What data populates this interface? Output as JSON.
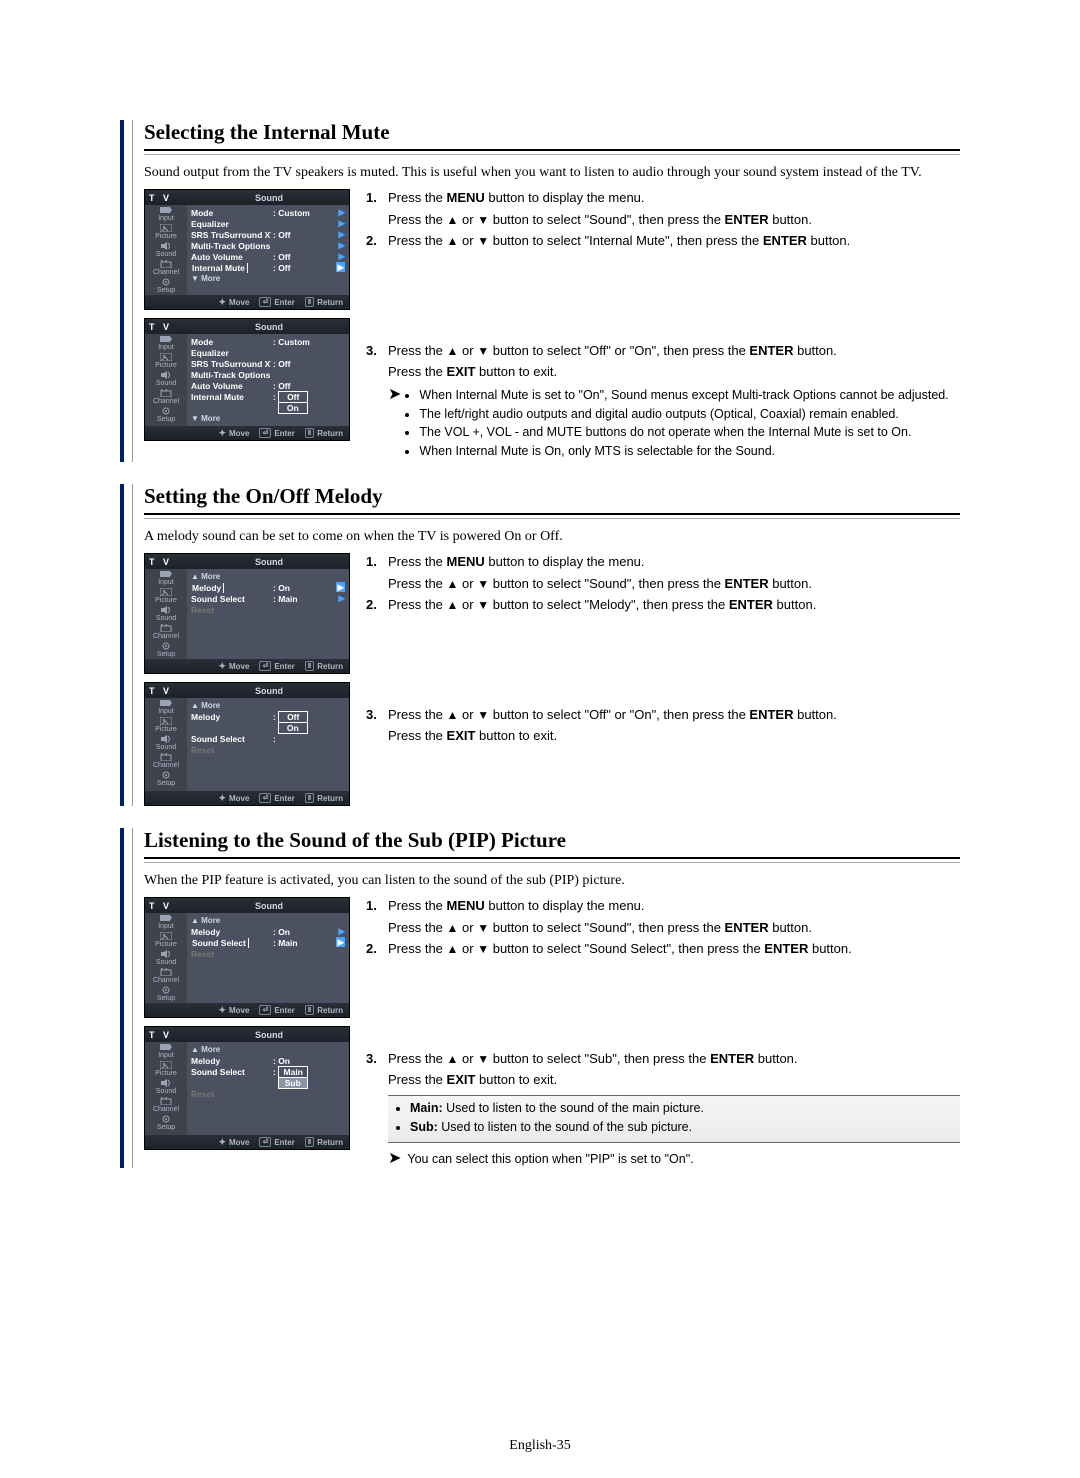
{
  "page_number": "English-35",
  "arrows": {
    "up": "▲",
    "down": "▼",
    "right": "▶",
    "callout": "➤"
  },
  "tv_label": "T V",
  "sidebar": [
    "Input",
    "Picture",
    "Sound",
    "Channel",
    "Setup"
  ],
  "footer": {
    "move": "Move",
    "enter": "Enter",
    "return": "Return"
  },
  "sec1": {
    "title": "Selecting the Internal Mute",
    "intro": "Sound output from the TV speakers is muted. This is useful when you want to listen to audio through your sound system instead of the TV.",
    "step1a": "Press the MENU button to display the menu.",
    "step1b_pre": "Press the ",
    "step1b_mid": " or ",
    "step1b_post": " button to select \"Sound\", then press the ENTER button.",
    "step2_pre": "Press the ",
    "step2_mid": " or ",
    "step2_post": " button to select \"Internal Mute\", then press the ENTER button.",
    "step3_pre": "Press the ",
    "step3_mid": " or ",
    "step3_post": " button to select \"Off\" or \"On\", then press the ENTER button.",
    "step3_exit": "Press the EXIT button to exit.",
    "callout": [
      "When Internal Mute is set to \"On\", Sound menus except Multi-track Options cannot be adjusted.",
      "The left/right audio outputs and digital audio outputs (Optical, Coaxial) remain enabled.",
      "The VOL +, VOL - and MUTE buttons do not operate when the Internal Mute is set to On.",
      "When Internal Mute is On, only MTS is selectable for the Sound."
    ],
    "menu1": {
      "title": "Sound",
      "rows": [
        {
          "label": "Mode",
          "val": ": Custom",
          "arrow": true,
          "sel_label": false
        },
        {
          "label": "Equalizer",
          "val": "",
          "arrow": true
        },
        {
          "label": "SRS TruSurround XT",
          "val": ": Off",
          "arrow": true
        },
        {
          "label": "Multi-Track Options",
          "val": "",
          "arrow": true
        },
        {
          "label": "Auto Volume",
          "val": ": Off",
          "arrow": true
        },
        {
          "label": "Internal Mute",
          "val": ": Off",
          "arrow": true,
          "sel_label": true,
          "sel_arrow": true
        },
        {
          "label": "▼ More",
          "val": "",
          "more": true
        }
      ]
    },
    "menu2": {
      "title": "Sound",
      "rows": [
        {
          "label": "Mode",
          "val": ": Custom"
        },
        {
          "label": "Equalizer",
          "val": ""
        },
        {
          "label": "SRS TruSurround XT",
          "val": ": Off"
        },
        {
          "label": "Multi-Track Options",
          "val": ""
        },
        {
          "label": "Auto Volume",
          "val": ": Off"
        },
        {
          "label": "Internal Mute",
          "val_box": "Off",
          "sel_label": false,
          "extra_box": "On"
        },
        {
          "label": "▼ More",
          "val": "",
          "more": true
        }
      ]
    }
  },
  "sec2": {
    "title": "Setting the On/Off Melody",
    "intro": "A melody sound can be set to come on when the TV is powered On or Off.",
    "step1a": "Press the MENU button to display the menu.",
    "step1b_pre": "Press the ",
    "step1b_mid": " or ",
    "step1b_post": " button to select \"Sound\", then press the ENTER button.",
    "step2_pre": "Press the ",
    "step2_mid": " or ",
    "step2_post": " button to select \"Melody\", then press the ENTER button.",
    "step3_pre": "Press the ",
    "step3_mid": " or ",
    "step3_post": " button to select \"Off\" or \"On\", then press the ENTER button.",
    "step3_exit": "Press the EXIT button to exit.",
    "menu1": {
      "title": "Sound",
      "rows": [
        {
          "label": "▲ More",
          "val": "",
          "more": true
        },
        {
          "label": "Melody",
          "val": ": On",
          "arrow": true,
          "sel_label": true,
          "sel_arrow": true
        },
        {
          "label": "Sound Select",
          "val": ": Main",
          "arrow": true
        },
        {
          "label": "Reset",
          "val": "",
          "dim": true
        }
      ]
    },
    "menu2": {
      "title": "Sound",
      "rows": [
        {
          "label": "▲ More",
          "val": "",
          "more": true
        },
        {
          "label": "Melody",
          "val_box": "Off",
          "extra_box": "On"
        },
        {
          "label": "Sound Select",
          "val": ":"
        },
        {
          "label": "Reset",
          "val": "",
          "dim": true
        }
      ]
    }
  },
  "sec3": {
    "title": "Listening to the Sound of the Sub (PIP) Picture",
    "intro": "When the PIP feature is activated, you can listen to the sound of the sub (PIP) picture.",
    "step1a": "Press the MENU button to display the menu.",
    "step1b_pre": "Press the ",
    "step1b_mid": " or ",
    "step1b_post": " button to select \"Sound\", then press the ENTER button.",
    "step2_pre": "Press the ",
    "step2_mid": " or ",
    "step2_post": " button to select \"Sound Select\", then press the ENTER button.",
    "step3_pre": "Press the ",
    "step3_mid": " or ",
    "step3_post": " button to select \"Sub\", then press the ENTER button.",
    "step3_exit": "Press the EXIT button to exit.",
    "note": [
      "Main: Used to listen to the sound of the main picture.",
      "Sub: Used to listen to the sound of the sub picture."
    ],
    "arrow_note": "You can select this option when \"PIP\" is set to \"On\".",
    "menu1": {
      "title": "Sound",
      "rows": [
        {
          "label": "▲ More",
          "val": "",
          "more": true
        },
        {
          "label": "Melody",
          "val": ": On",
          "arrow": true
        },
        {
          "label": "Sound Select",
          "val": ": Main",
          "arrow": true,
          "sel_label": true,
          "sel_arrow": true
        },
        {
          "label": "Reset",
          "val": "",
          "dim": true
        }
      ]
    },
    "menu2": {
      "title": "Sound",
      "rows": [
        {
          "label": "▲ More",
          "val": "",
          "more": true
        },
        {
          "label": "Melody",
          "val": ": On"
        },
        {
          "label": "Sound Select",
          "val_box": "Main",
          "extra_box_fill": "Sub"
        },
        {
          "label": "Reset",
          "val": "",
          "dim": true
        }
      ]
    }
  }
}
